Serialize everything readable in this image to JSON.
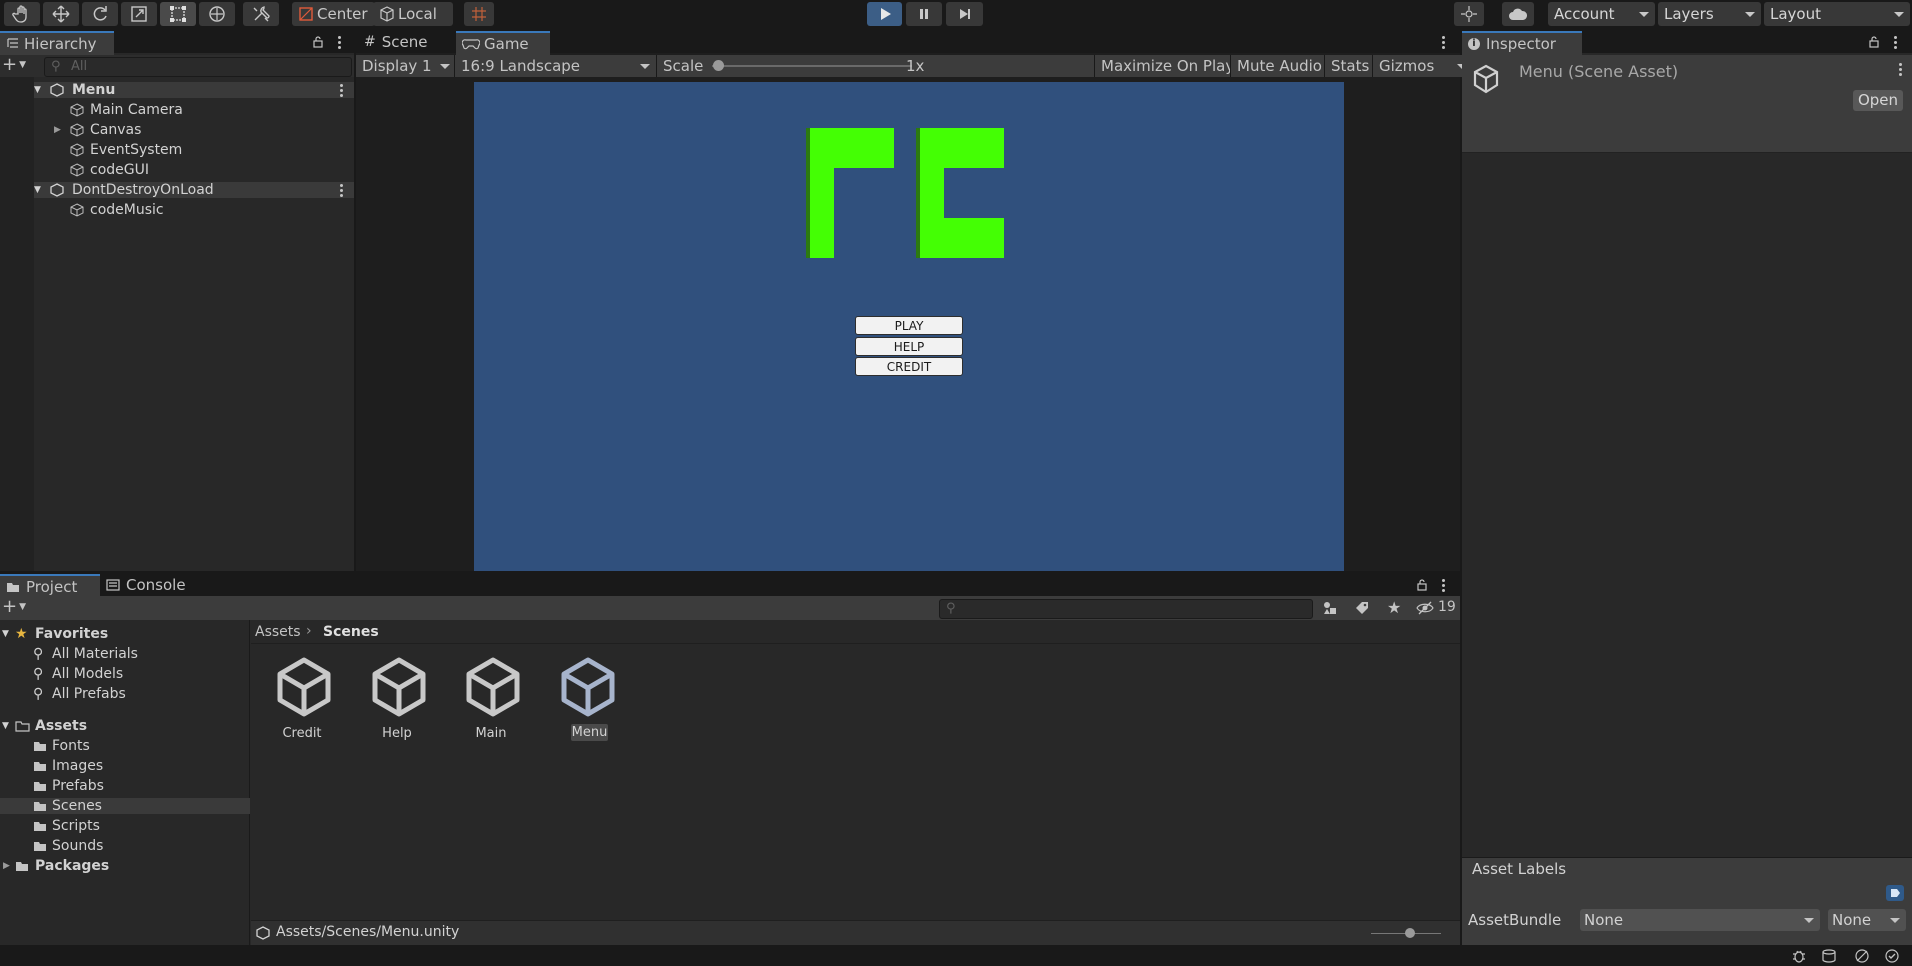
{
  "toolbar": {
    "pivot_label": "Center",
    "space_label": "Local",
    "account_label": "Account",
    "layers_label": "Layers",
    "layout_label": "Layout",
    "accent_color": "#3a79bb"
  },
  "hierarchy": {
    "tab_label": "Hierarchy",
    "search_placeholder": "All",
    "items": [
      {
        "label": "Menu",
        "type": "scene"
      },
      {
        "label": "Main Camera",
        "type": "gameobject"
      },
      {
        "label": "Canvas",
        "type": "gameobject"
      },
      {
        "label": "EventSystem",
        "type": "gameobject"
      },
      {
        "label": "codeGUI",
        "type": "gameobject"
      },
      {
        "label": "DontDestroyOnLoad",
        "type": "scene"
      },
      {
        "label": "codeMusic",
        "type": "gameobject"
      }
    ]
  },
  "view": {
    "tabs": [
      {
        "label": "Scene"
      },
      {
        "label": "Game",
        "selected": true
      }
    ],
    "display_label": "Display 1",
    "aspect_label": "16:9 Landscape",
    "scale_label": "Scale",
    "scale_value": "1x",
    "maximize_label": "Maximize On Play",
    "mute_label": "Mute Audio",
    "stats_label": "Stats",
    "gizmos_label": "Gizmos"
  },
  "game": {
    "background_color": "#30507d",
    "logo_color": "#44ff04",
    "buttons": [
      {
        "label": "PLAY"
      },
      {
        "label": "HELP"
      },
      {
        "label": "CREDIT"
      }
    ]
  },
  "project": {
    "tabs": [
      {
        "label": "Project",
        "selected": true
      },
      {
        "label": "Console"
      }
    ],
    "hidden_count": "19",
    "favorites": {
      "label": "Favorites",
      "items": [
        {
          "label": "All Materials"
        },
        {
          "label": "All Models"
        },
        {
          "label": "All Prefabs"
        }
      ]
    },
    "assets": {
      "label": "Assets",
      "folders": [
        {
          "label": "Fonts"
        },
        {
          "label": "Images"
        },
        {
          "label": "Prefabs"
        },
        {
          "label": "Scenes",
          "selected": true
        },
        {
          "label": "Scripts"
        },
        {
          "label": "Sounds"
        }
      ]
    },
    "packages_label": "Packages",
    "breadcrumb": {
      "root": "Assets",
      "current": "Scenes"
    },
    "scenes": [
      {
        "label": "Credit"
      },
      {
        "label": "Help"
      },
      {
        "label": "Main"
      },
      {
        "label": "Menu",
        "selected": true
      }
    ],
    "status_path": "Assets/Scenes/Menu.unity"
  },
  "inspector": {
    "tab_label": "Inspector",
    "title": "Menu (Scene Asset)",
    "open_label": "Open",
    "asset_labels_title": "Asset Labels",
    "assetbundle_label": "AssetBundle",
    "assetbundle_value": "None",
    "variant_value": "None"
  }
}
